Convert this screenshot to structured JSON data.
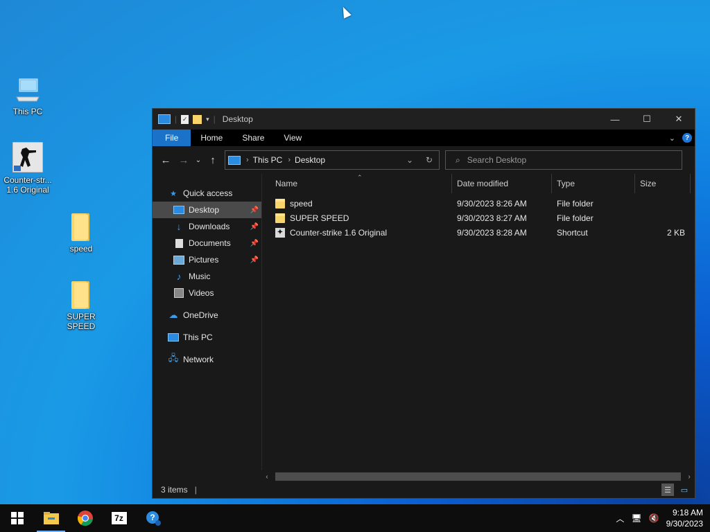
{
  "desktop": {
    "icons": [
      {
        "label": "This PC"
      },
      {
        "label": "Counter-str... 1.6 Original"
      },
      {
        "label": "speed"
      },
      {
        "label": "SUPER SPEED"
      }
    ]
  },
  "window": {
    "title": "Desktop",
    "controls": {
      "minimize": "—",
      "maximize": "☐",
      "close": "✕"
    },
    "ribbon": {
      "file": "File",
      "home": "Home",
      "share": "Share",
      "view": "View"
    },
    "address": {
      "root": "This PC",
      "current": "Desktop"
    },
    "search": {
      "placeholder": "Search Desktop"
    },
    "nav_pane": [
      {
        "label": "Quick access"
      },
      {
        "label": "Desktop"
      },
      {
        "label": "Downloads"
      },
      {
        "label": "Documents"
      },
      {
        "label": "Pictures"
      },
      {
        "label": "Music"
      },
      {
        "label": "Videos"
      },
      {
        "label": "OneDrive"
      },
      {
        "label": "This PC"
      },
      {
        "label": "Network"
      }
    ],
    "columns": {
      "name": "Name",
      "date": "Date modified",
      "type": "Type",
      "size": "Size"
    },
    "files": [
      {
        "name": "speed",
        "date": "9/30/2023 8:26 AM",
        "type": "File folder",
        "size": ""
      },
      {
        "name": "SUPER SPEED",
        "date": "9/30/2023 8:27 AM",
        "type": "File folder",
        "size": ""
      },
      {
        "name": "Counter-strike 1.6 Original",
        "date": "9/30/2023 8:28 AM",
        "type": "Shortcut",
        "size": "2 KB"
      }
    ],
    "status": {
      "items": "3 items"
    }
  },
  "taskbar": {
    "apps": [
      {
        "icon": "windows-start-icon"
      },
      {
        "icon": "file-explorer-icon"
      },
      {
        "icon": "chrome-icon"
      },
      {
        "icon": "7zip-icon"
      },
      {
        "icon": "help-icon"
      }
    ],
    "clock": {
      "time": "9:18 AM",
      "date": "9/30/2023"
    }
  }
}
